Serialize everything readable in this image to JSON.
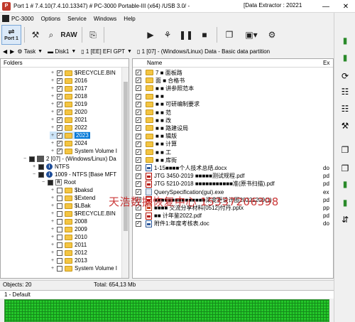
{
  "window": {
    "title": "Port 1 # 7.4.10(7.4.10.13347) # PC-3000 Portable-III (x64) /USB 3.0/ - ",
    "title_right": "[Data Extractor : 20221",
    "minimize": "—",
    "close": "✕"
  },
  "menu": {
    "app_label": "PC-3000",
    "items": [
      "Options",
      "Service",
      "Windows",
      "Help"
    ]
  },
  "toolbar": {
    "port_label": "Port 1",
    "raw_label": "RAW"
  },
  "breadcrumb": {
    "task": "Task",
    "disk": "Disk1",
    "partition1": "1 [EE] EFI GPT",
    "partition2": "1 [07] - (Windows/Linux) Data - Basic data partition"
  },
  "folders_pane": {
    "header": "Folders",
    "rows": [
      {
        "label": "$RECYCLE.BIN",
        "indent": 5,
        "type": "folder",
        "checked": true
      },
      {
        "label": "2016",
        "indent": 5,
        "type": "folder",
        "checked": true
      },
      {
        "label": "2017",
        "indent": 5,
        "type": "folder",
        "checked": true
      },
      {
        "label": "2018",
        "indent": 5,
        "type": "folder",
        "checked": true
      },
      {
        "label": "2019",
        "indent": 5,
        "type": "folder",
        "checked": true
      },
      {
        "label": "2020",
        "indent": 5,
        "type": "folder",
        "checked": true
      },
      {
        "label": "2021",
        "indent": 5,
        "type": "folder",
        "checked": true
      },
      {
        "label": "2022",
        "indent": 5,
        "type": "folder",
        "checked": true
      },
      {
        "label": "2023",
        "indent": 5,
        "type": "folder",
        "checked": true,
        "selected": true
      },
      {
        "label": "2024",
        "indent": 5,
        "type": "folder",
        "checked": true
      },
      {
        "label": "System Volume I",
        "indent": 5,
        "type": "folder",
        "checked": true
      },
      {
        "label": "2 [07] - (Windows/Linux) Da",
        "indent": 2,
        "type": "drive",
        "checked": false,
        "expander": "−"
      },
      {
        "label": "NTFS",
        "indent": 3,
        "type": "info",
        "checked": false,
        "expander": "+"
      },
      {
        "label": "1009 - NTFS [Base MFT",
        "indent": 3,
        "type": "info",
        "checked": false,
        "expander": "−"
      },
      {
        "label": "Root",
        "indent": 4,
        "type": "root",
        "checked": false,
        "expander": "−"
      },
      {
        "label": "$baksd",
        "indent": 5,
        "type": "folder",
        "checked": false
      },
      {
        "label": "$Extend",
        "indent": 5,
        "type": "folder",
        "checked": false
      },
      {
        "label": "$LBak",
        "indent": 5,
        "type": "folder",
        "checked": false
      },
      {
        "label": "$RECYCLE.BIN",
        "indent": 5,
        "type": "folder",
        "checked": false
      },
      {
        "label": "2008",
        "indent": 5,
        "type": "folder",
        "checked": false
      },
      {
        "label": "2009",
        "indent": 5,
        "type": "folder",
        "checked": false
      },
      {
        "label": "2010",
        "indent": 5,
        "type": "folder",
        "checked": false
      },
      {
        "label": "2011",
        "indent": 5,
        "type": "folder",
        "checked": false
      },
      {
        "label": "2012",
        "indent": 5,
        "type": "folder",
        "checked": false
      },
      {
        "label": "2013",
        "indent": 5,
        "type": "folder",
        "checked": false
      },
      {
        "label": "System Volume I",
        "indent": 5,
        "type": "folder",
        "checked": false
      }
    ]
  },
  "files_pane": {
    "col_name": "Name",
    "col_ext": "Ex",
    "rows": [
      {
        "name": "7 ■ 面板路",
        "type": "folder",
        "ext": ""
      },
      {
        "name": "面 ■ 合格书",
        "type": "folder",
        "ext": ""
      },
      {
        "name": "■ ■ 讲参照范本",
        "type": "folder",
        "ext": ""
      },
      {
        "name": "■ ■",
        "type": "folder",
        "ext": ""
      },
      {
        "name": "■ ■ 可研编制要求",
        "type": "folder",
        "ext": ""
      },
      {
        "name": "■ ■ 范",
        "type": "folder",
        "ext": ""
      },
      {
        "name": "■ ■ 改",
        "type": "folder",
        "ext": ""
      },
      {
        "name": "■ ■ 路建设局",
        "type": "folder",
        "ext": ""
      },
      {
        "name": "■ ■ 辑版",
        "type": "folder",
        "ext": ""
      },
      {
        "name": "■ ■ 计算",
        "type": "folder",
        "ext": ""
      },
      {
        "name": "■ ■ 工",
        "type": "folder",
        "ext": ""
      },
      {
        "name": "■ ■ 库街",
        "type": "folder",
        "ext": ""
      },
      {
        "name": "1-15■■■■个人技术总结.docx",
        "type": "doc",
        "ext": "do"
      },
      {
        "name": "JTG 3450-2019 ■■■■■测试规程.pdf",
        "type": "pdf",
        "ext": "pd"
      },
      {
        "name": "JTG 5210-2018 ■■■■■■■■■■■准(原书扫描).pdf",
        "type": "pdf",
        "ext": "pd"
      },
      {
        "name": "QuerySpecification(gui).exe",
        "type": "exe",
        "ext": "ex"
      },
      {
        "name": "■■■■■■■■■■■■■■■梁变更设计图20221209(1)",
        "type": "pdf",
        "ext": "pd"
      },
      {
        "name": "■■■■ 交流分享材料(0512)付丹.pptx",
        "type": "ppt",
        "ext": "pp"
      },
      {
        "name": "■■ 计年鉴2022.pdf",
        "type": "pdf",
        "ext": "pd"
      },
      {
        "name": "附件1:年度考核表.doc",
        "type": "doc",
        "ext": "do"
      }
    ]
  },
  "watermark": "天浩数据恢复中心 15337206398",
  "status": {
    "objects": "Objects: 20",
    "total": "Total: 654,13 Mb"
  },
  "map": {
    "label": "1 - Default"
  },
  "colors": {
    "selection": "#0078d7",
    "folder": "#f4c543",
    "map_green": "#24c82a",
    "watermark": "#c62222"
  }
}
